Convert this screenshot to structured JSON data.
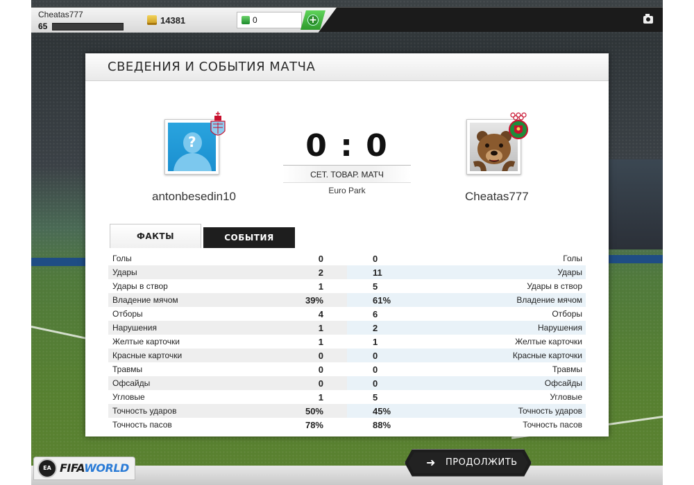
{
  "topbar": {
    "player_name": "Cheatas777",
    "level": "65",
    "coins": "14381",
    "fifa_points": "0",
    "add_symbol": "+",
    "camera_icon": "camera-icon"
  },
  "panel": {
    "title": "СВЕДЕНИЯ И СОБЫТИЯ МАТЧА"
  },
  "match": {
    "home_name": "antonbesedin10",
    "away_name": "Cheatas777",
    "score": "0 : 0",
    "match_type": "СЕТ. ТОВАР. МАТЧ",
    "stadium": "Euro Park"
  },
  "tabs": [
    {
      "label": "ФАКТЫ",
      "active": true
    },
    {
      "label": "СОБЫТИЯ",
      "active": false
    }
  ],
  "stats": [
    {
      "label": "Голы",
      "home": "0",
      "away": "0"
    },
    {
      "label": "Удары",
      "home": "2",
      "away": "11"
    },
    {
      "label": "Удары в створ",
      "home": "1",
      "away": "5"
    },
    {
      "label": "Владение мячом",
      "home": "39%",
      "away": "61%"
    },
    {
      "label": "Отборы",
      "home": "4",
      "away": "6"
    },
    {
      "label": "Нарушения",
      "home": "1",
      "away": "2"
    },
    {
      "label": "Желтые карточки",
      "home": "1",
      "away": "1"
    },
    {
      "label": "Красные карточки",
      "home": "0",
      "away": "0"
    },
    {
      "label": "Травмы",
      "home": "0",
      "away": "0"
    },
    {
      "label": "Офсайды",
      "home": "0",
      "away": "0"
    },
    {
      "label": "Угловые",
      "home": "1",
      "away": "5"
    },
    {
      "label": "Точность ударов",
      "home": "50%",
      "away": "45%"
    },
    {
      "label": "Точность пасов",
      "home": "78%",
      "away": "88%"
    }
  ],
  "footer": {
    "ea_badge": "EA",
    "logo_fifa": "FIFA",
    "logo_world": "WORLD",
    "continue_arrow": "➜",
    "continue_label": "ПРОДОЛЖИТЬ"
  },
  "colors": {
    "accent_green": "#2e9a2c",
    "tab_dark": "#1e1e1e",
    "logo_blue": "#2a7bd6"
  }
}
